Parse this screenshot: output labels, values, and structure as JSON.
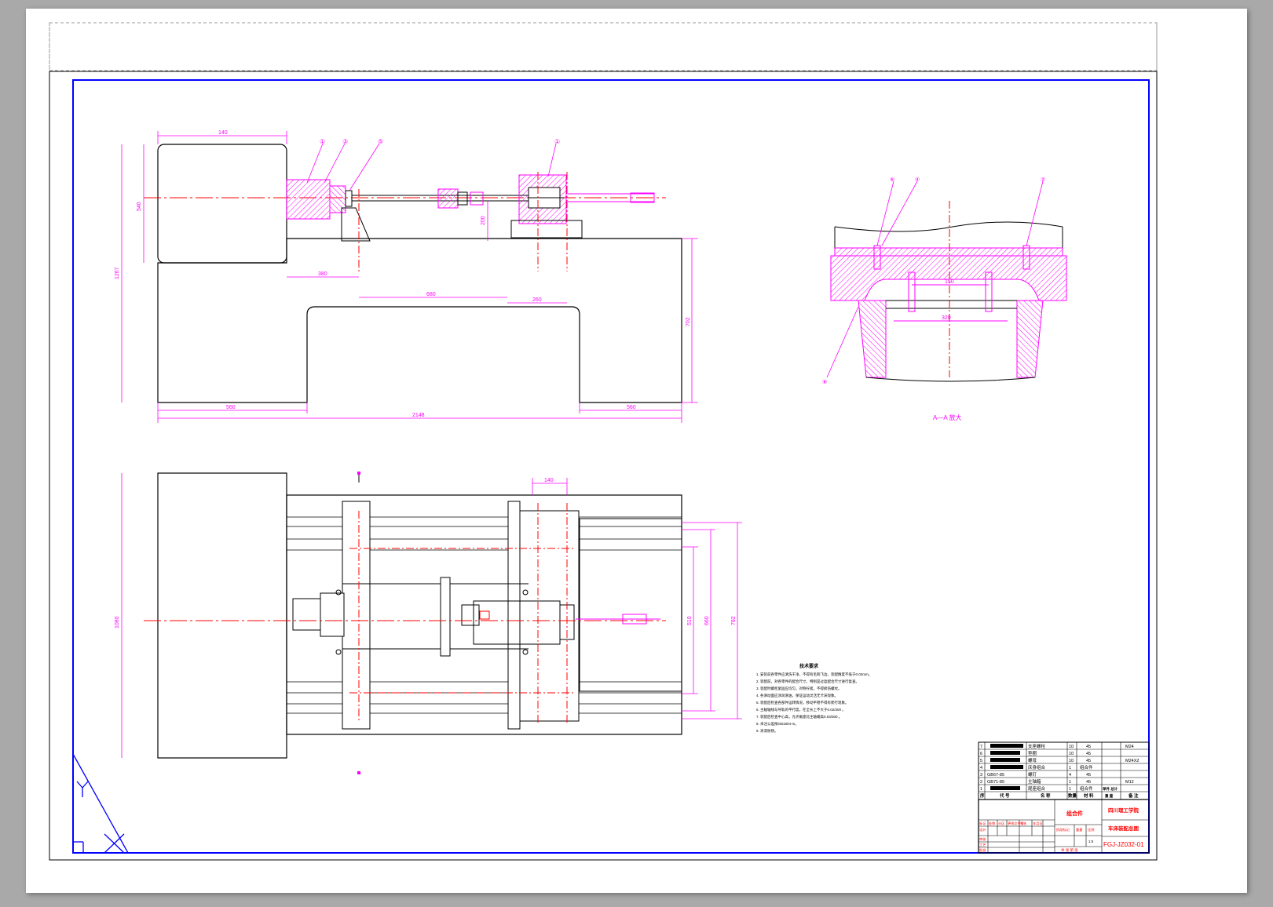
{
  "colors": {
    "frame": "#0000ff",
    "outline": "#000000",
    "dimension": "#ff00ff",
    "centerline": "#ff0000",
    "hatch": "#ff00ff",
    "background": "#a9a9a9"
  },
  "front_view": {
    "dims": {
      "top_width": "140",
      "height_total": "1267",
      "height_block": "540",
      "offset": "380",
      "span_mid": "680",
      "span_right": "260",
      "riser": "200",
      "table_height": "702",
      "left_foot": "560",
      "overall_length": "2148",
      "right_foot": "560"
    },
    "balloons": [
      "①",
      "③",
      "⑤",
      "①"
    ]
  },
  "section_view": {
    "caption": "A—A 放大",
    "dims": {
      "bolt_spacing": "150",
      "inner_width": "320"
    },
    "balloons": [
      "⑥",
      "④",
      "②",
      "⑧"
    ]
  },
  "plan_view": {
    "dims": {
      "top_width": "140",
      "height": "1080",
      "d1": "510",
      "d2": "660",
      "d3": "782"
    }
  },
  "tech_requirements": {
    "title": "技术要求",
    "lines": [
      "1. 安装前各零件应清洗干净，不得有毛刺飞边，装配精度不低于0.02mm。",
      "2. 装配前，对各零件的配合尺寸，特别是过盈配合尺寸进行复查。",
      "3. 装配时螺栓紧固应均匀，对称拧紧，不得损伤螺纹。",
      "4. 各滑动面应涂润滑油，保证运动灵活无卡滞现象。",
      "5. 装配后检查各部件运转情况，移动平稳不得有爬行现象。",
      "6. 主轴轴线与导轨的平行度，在全长上不大于0.02/300 。",
      "7. 装配后检查中心高，允许尾座比主轴箱高0.03/300 。",
      "8. 未注公差按GB1804-m。",
      "9. 涂漆防锈。"
    ]
  },
  "bom": {
    "rows": [
      {
        "no": "7",
        "code": "",
        "name": "支座螺栓",
        "qty": "10",
        "mat": "45",
        "note": "M24"
      },
      {
        "no": "6",
        "code": "",
        "name": "垫圈",
        "qty": "10",
        "mat": "45",
        "note": ""
      },
      {
        "no": "5",
        "code": "",
        "name": "螺母",
        "qty": "10",
        "mat": "45",
        "note": "M24X2"
      },
      {
        "no": "4",
        "code": "",
        "name": "床身组合",
        "qty": "1",
        "mat": "组合件",
        "note": ""
      },
      {
        "no": "3",
        "code": "GB67-85",
        "name": "螺钉",
        "qty": "4",
        "mat": "45",
        "note": ""
      },
      {
        "no": "2",
        "code": "GB71-85",
        "name": "主轴箱",
        "qty": "1",
        "mat": "45",
        "note": "M12"
      },
      {
        "no": "1",
        "code": "",
        "name": "尾座组合",
        "qty": "1",
        "mat": "组合件",
        "note": ""
      }
    ],
    "header": {
      "no": "序",
      "code": "代 号",
      "name": "名 称",
      "qty": "数量",
      "mat": "材 料",
      "weight": "单件 总计",
      "weight2": "重 量",
      "note": "备 注"
    }
  },
  "title_block": {
    "material": "组合件",
    "school": "四川理工学院",
    "drawing_name": "车床装配总图",
    "drawing_no": "FGJ-JZ032-01",
    "scale": "1:5",
    "sheet": "共 张 第 张",
    "labels": [
      "标记",
      "处数",
      "分区",
      "更改文件号",
      "签名",
      "年月日",
      "设计",
      "审核",
      "工艺",
      "批准",
      "阶段标记",
      "重量",
      "比例"
    ]
  }
}
